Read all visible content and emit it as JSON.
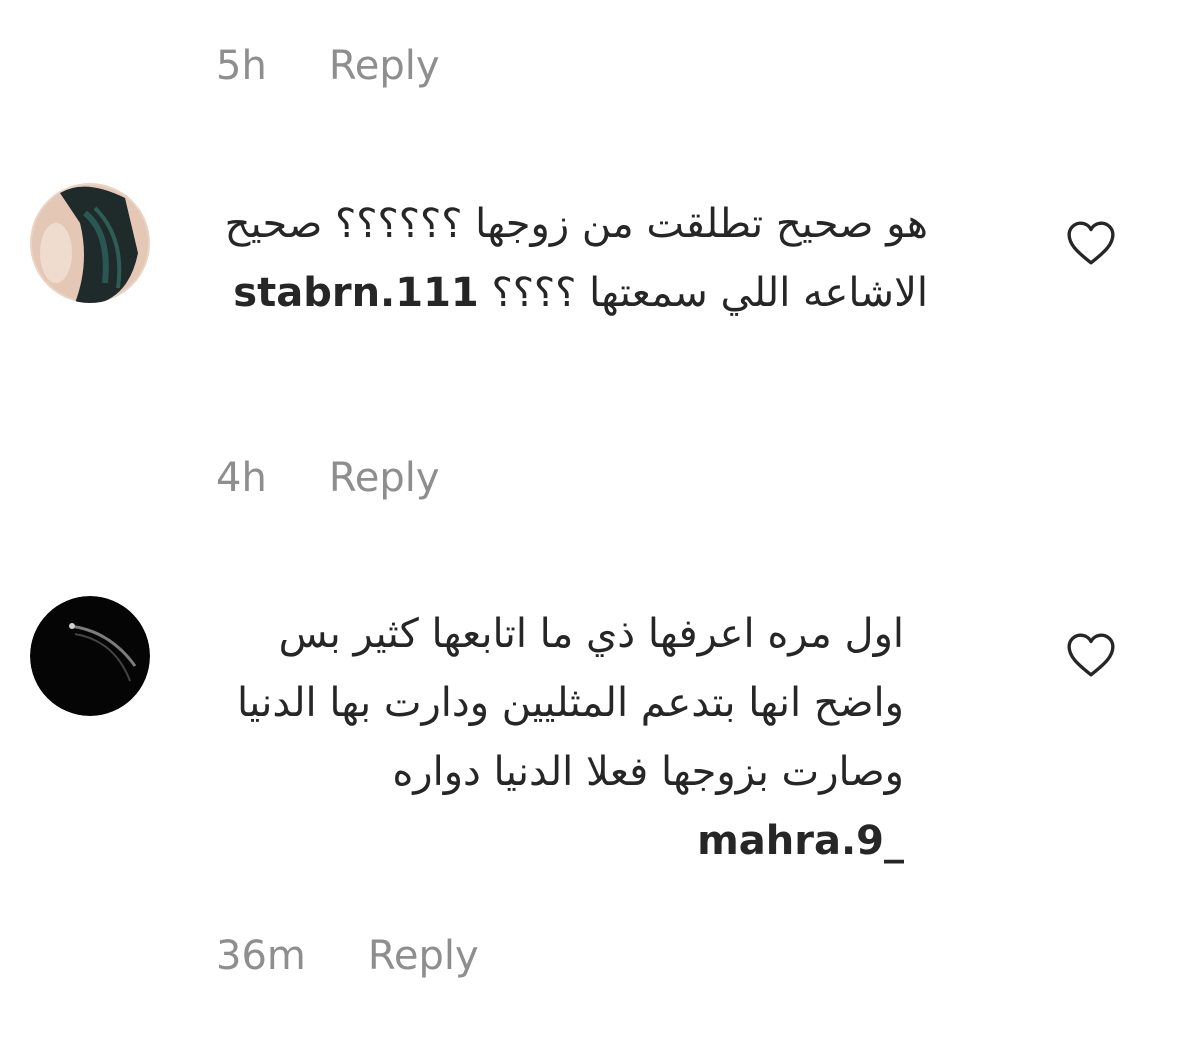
{
  "comments": [
    {
      "username": "",
      "time": "5h",
      "reply_label": "Reply"
    },
    {
      "username": "stabrn.111",
      "text": "هو صحيح تطلقت من زوجها ؟؟؟؟؟؟ صحيح الاشاعه اللي سمعتها ؟؟؟؟",
      "time": "4h",
      "reply_label": "Reply",
      "avatar_icon": "profile-photo",
      "like_icon": "heart-outline-icon"
    },
    {
      "username": "mahra.9_",
      "text": "اول مره اعرفها ذي ما اتابعها كثير بس واضح انها بتدعم المثليين ودارت بها الدنيا وصارت بزوجها فعلا الدنيا دواره",
      "time": "36m",
      "reply_label": "Reply",
      "avatar_icon": "profile-photo",
      "like_icon": "heart-outline-icon"
    }
  ],
  "colors": {
    "text": "#262626",
    "meta": "#8e8e8e",
    "background": "#ffffff"
  }
}
